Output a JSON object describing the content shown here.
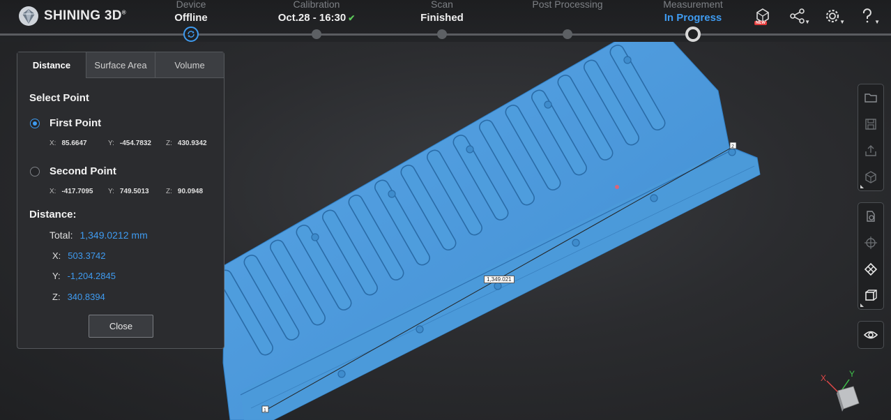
{
  "app": {
    "logo_text": "SHINING 3D",
    "logo_mark": "®"
  },
  "steps": [
    {
      "title": "Device",
      "value": "Offline"
    },
    {
      "title": "Calibration",
      "value": "Oct.28 - 16:30"
    },
    {
      "title": "Scan",
      "value": "Finished"
    },
    {
      "title": "Post Processing",
      "value": ""
    },
    {
      "title": "Measurement",
      "value": "In Progress"
    }
  ],
  "top_icons": {
    "model_icon": "model-new-icon",
    "new_badge": "NEW",
    "share_icon": "share-icon",
    "settings_icon": "gear-icon",
    "help_icon": "help-icon"
  },
  "panel": {
    "tabs": [
      "Distance",
      "Surface Area",
      "Volume"
    ],
    "select_point_title": "Select Point",
    "first_point": {
      "label": "First Point",
      "x_label": "X:",
      "x": "85.6647",
      "y_label": "Y:",
      "y": "-454.7832",
      "z_label": "Z:",
      "z": "430.9342"
    },
    "second_point": {
      "label": "Second Point",
      "x_label": "X:",
      "x": "-417.7095",
      "y_label": "Y:",
      "y": "749.5013",
      "z_label": "Z:",
      "z": "90.0948"
    },
    "distance_title": "Distance:",
    "total_label": "Total:",
    "total_value": "1,349.0212  mm",
    "dx_label": "X:",
    "dx_value": "503.3742",
    "dy_label": "Y:",
    "dy_value": "-1,204.2845",
    "dz_label": "Z:",
    "dz_value": "340.8394",
    "close_label": "Close"
  },
  "scene": {
    "dimension_label": "1,349.021",
    "point1_marker": "1",
    "point2_marker": "2",
    "axis_x": "X",
    "axis_y": "Y",
    "model_color": "#4a97d8"
  },
  "right_toolbar": {
    "group1": [
      "folder-icon",
      "save-icon",
      "export-icon",
      "cube-icon"
    ],
    "group2": [
      "measure-icon",
      "target-icon",
      "align-icon",
      "view-cube-icon"
    ],
    "group3": [
      "eye-icon"
    ]
  }
}
